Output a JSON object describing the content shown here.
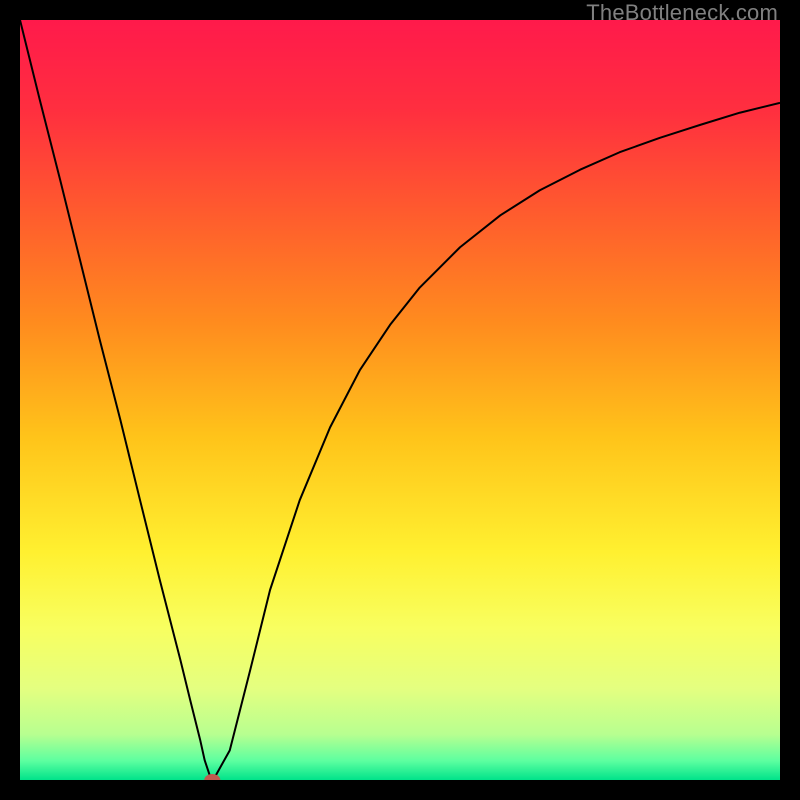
{
  "watermark": "TheBottleneck.com",
  "chart_data": {
    "type": "line",
    "title": "",
    "xlabel": "",
    "ylabel": "",
    "xlim": [
      0,
      100
    ],
    "ylim": [
      0,
      100
    ],
    "grid": false,
    "legend": false,
    "series": [
      {
        "name": "curve",
        "x": [
          0.0,
          2.6,
          5.3,
          7.9,
          10.5,
          13.2,
          15.8,
          18.4,
          21.1,
          22.4,
          23.7,
          24.3,
          25.0,
          25.7,
          27.6,
          30.3,
          32.9,
          36.8,
          40.8,
          44.7,
          48.7,
          52.6,
          57.9,
          63.2,
          68.4,
          73.7,
          78.9,
          84.2,
          89.5,
          94.7,
          100.0
        ],
        "y": [
          100.0,
          89.5,
          78.9,
          68.4,
          57.9,
          47.4,
          36.8,
          26.3,
          15.8,
          10.5,
          5.3,
          2.6,
          0.5,
          0.5,
          3.9,
          14.5,
          25.0,
          36.8,
          46.4,
          53.9,
          59.9,
          64.8,
          70.1,
          74.3,
          77.6,
          80.3,
          82.6,
          84.5,
          86.2,
          87.8,
          89.1
        ]
      }
    ],
    "marker": {
      "x": 25.3,
      "y": 0.0,
      "color": "#c05a4f"
    },
    "background_gradient": {
      "stops": [
        {
          "pos": 0.0,
          "color": "#ff1a4b"
        },
        {
          "pos": 0.12,
          "color": "#ff2f3f"
        },
        {
          "pos": 0.25,
          "color": "#ff5a2e"
        },
        {
          "pos": 0.4,
          "color": "#ff8c1e"
        },
        {
          "pos": 0.55,
          "color": "#ffc41a"
        },
        {
          "pos": 0.7,
          "color": "#fff030"
        },
        {
          "pos": 0.8,
          "color": "#f8ff60"
        },
        {
          "pos": 0.88,
          "color": "#e4ff80"
        },
        {
          "pos": 0.94,
          "color": "#b7ff90"
        },
        {
          "pos": 0.975,
          "color": "#5cffa0"
        },
        {
          "pos": 1.0,
          "color": "#00e38a"
        }
      ]
    }
  }
}
